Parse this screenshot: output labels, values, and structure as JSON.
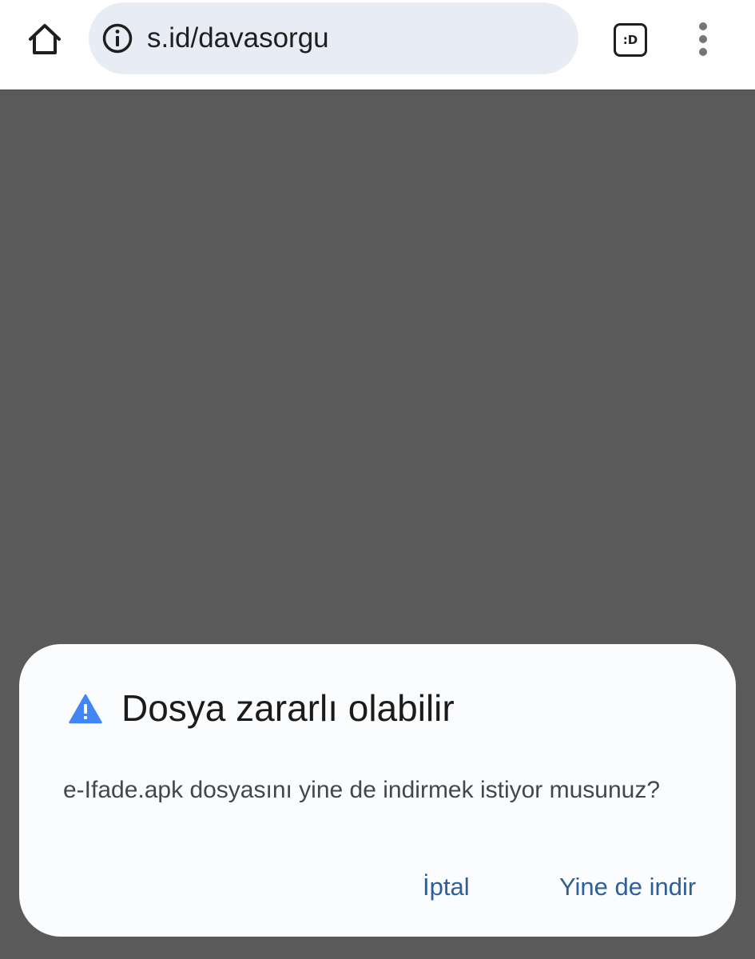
{
  "browser": {
    "url": "s.id/davasorgu",
    "tab_count_label": ":D",
    "icons": {
      "home": "home-icon",
      "site_info": "info-icon",
      "tab_switcher": "tab-switcher-icon",
      "menu": "more-vert-icon"
    }
  },
  "dialog": {
    "title": "Dosya zararlı olabilir",
    "body": "e-Ifade.apk dosyasını yine de indirmek istiyor musunuz?",
    "cancel_label": "İptal",
    "confirm_label": "Yine de indir",
    "icon": "warning-icon"
  },
  "colors": {
    "page_background": "#5a5a5a",
    "omnibox_background": "#e8ecf4",
    "dialog_background": "#fbfcfe",
    "accent": "#2f5f99",
    "warning": "#4285f4"
  }
}
